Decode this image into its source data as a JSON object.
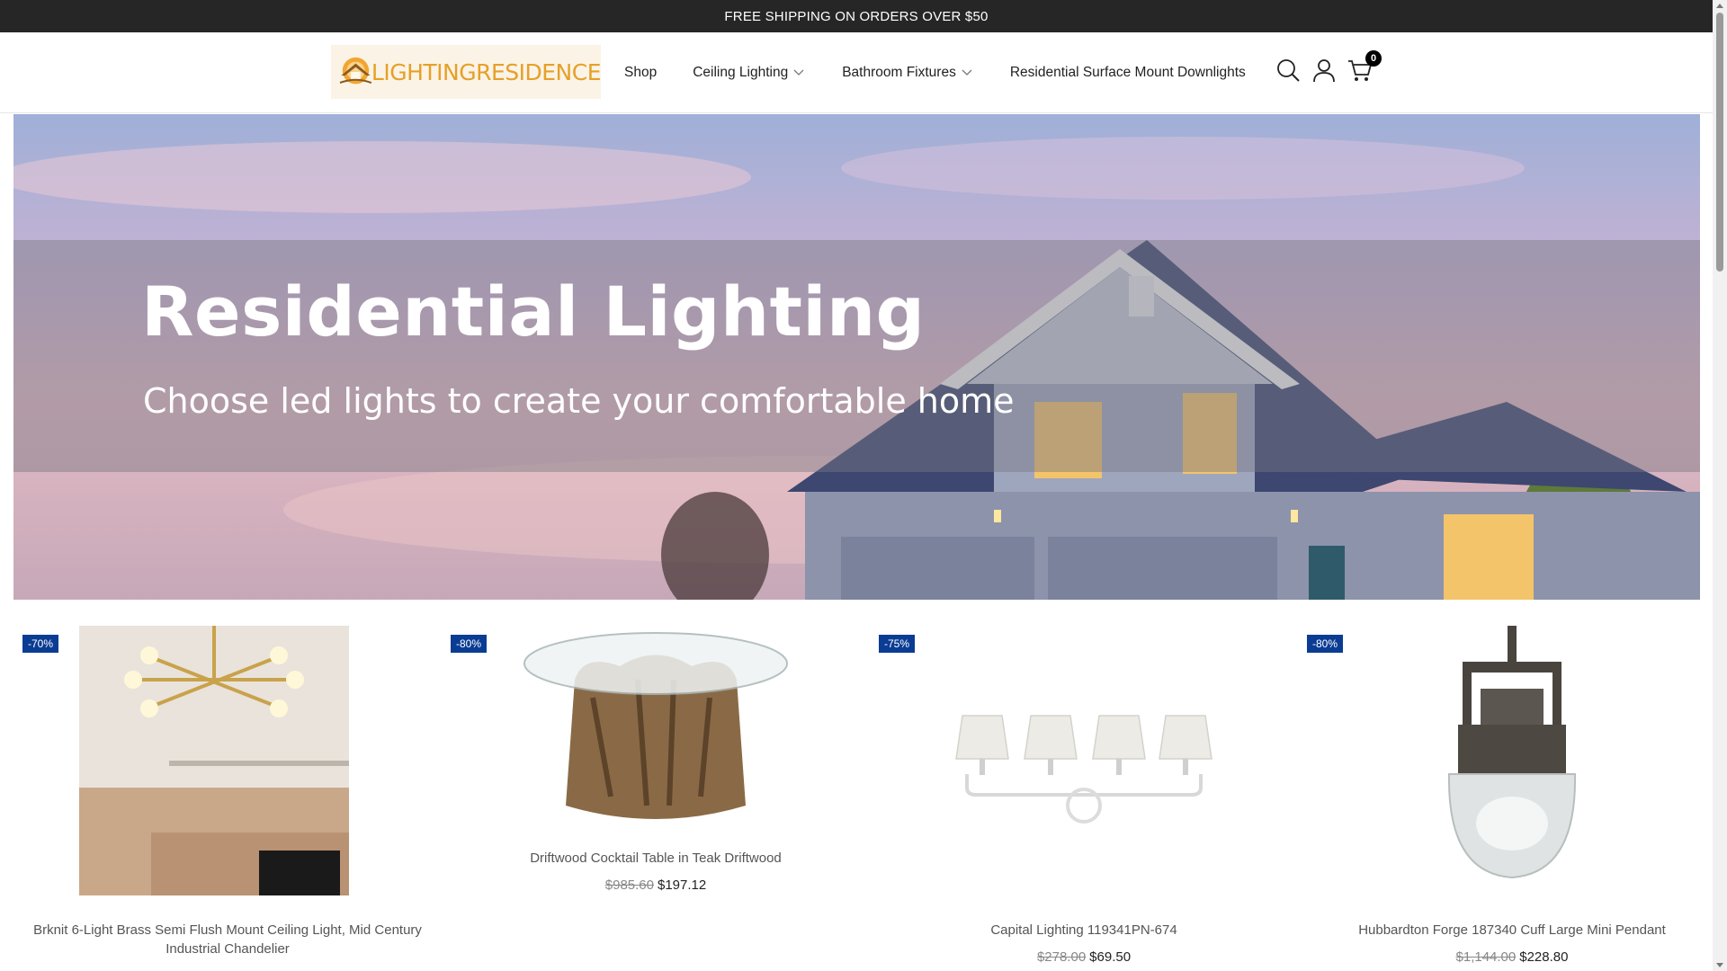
{
  "announcement": {
    "text": "FREE SHIPPING ON ORDERS OVER $50"
  },
  "header": {
    "logo_text": "LIGHTINGRESIDENCE",
    "nav": [
      {
        "label": "Shop",
        "has_dropdown": false
      },
      {
        "label": "Ceiling Lighting",
        "has_dropdown": true
      },
      {
        "label": "Bathroom Fixtures",
        "has_dropdown": true
      },
      {
        "label": "Residential Surface Mount Downlights",
        "has_dropdown": false
      }
    ],
    "icons": [
      "search-icon",
      "user-icon",
      "cart-icon"
    ],
    "cart_count": "0"
  },
  "hero": {
    "title": "Residential Lighting",
    "subtitle": "Choose led lights to create your comfortable home"
  },
  "products": [
    {
      "badge": "-70%",
      "title": "Brknit 6-Light Brass Semi Flush Mount Ceiling Light, Mid Century Industrial Chandelier",
      "old_price": "",
      "price": ""
    },
    {
      "badge": "-80%",
      "title": "Driftwood Cocktail Table in Teak Driftwood",
      "old_price": "$985.60",
      "price": "$197.12"
    },
    {
      "badge": "-75%",
      "title": "Capital Lighting 119341PN-674",
      "old_price": "$278.00",
      "price": "$69.50"
    },
    {
      "badge": "-80%",
      "title": "Hubbardton Forge 187340 Cuff Large Mini Pendant",
      "old_price": "$1,144.00",
      "price": "$228.80"
    }
  ],
  "colors": {
    "announcement_bg": "#262626",
    "badge_bg": "#0b3c93",
    "logo_accent": "#e6a028"
  }
}
